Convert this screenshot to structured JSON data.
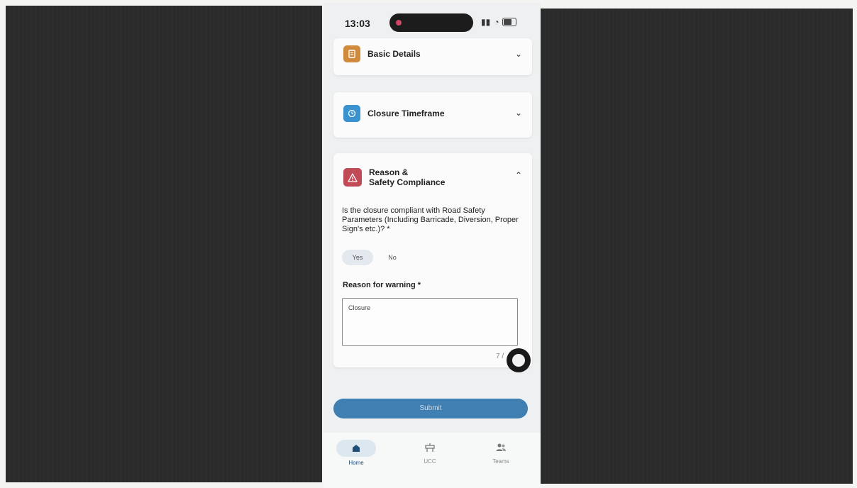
{
  "status_bar": {
    "time": "13:03"
  },
  "sections": [
    {
      "title": "Basic Details",
      "icon": "document-icon",
      "color": "#d08a3c",
      "expanded": false
    },
    {
      "title": "Closure Timeframe",
      "icon": "clock-icon",
      "color": "#3a93d0",
      "expanded": false
    },
    {
      "title_line1": "Reason &",
      "title_line2": "Safety Compliance",
      "icon": "warning-icon",
      "color": "#c04a55",
      "expanded": true
    }
  ],
  "form": {
    "question": "Is the closure compliant with Road Safety Parameters (Including Barricade, Diversion, Proper Sign's etc.)? *",
    "options": [
      "Yes",
      "No"
    ],
    "selected": "Yes",
    "reason_label": "Reason for warning *",
    "reason_value": "Closure",
    "char_counter": "7 /"
  },
  "submit_label": "Submit",
  "nav": [
    {
      "label": "Home",
      "icon": "home-icon",
      "active": true
    },
    {
      "label": "UCC",
      "icon": "barrier-icon",
      "active": false
    },
    {
      "label": "Teams",
      "icon": "people-icon",
      "active": false
    }
  ]
}
